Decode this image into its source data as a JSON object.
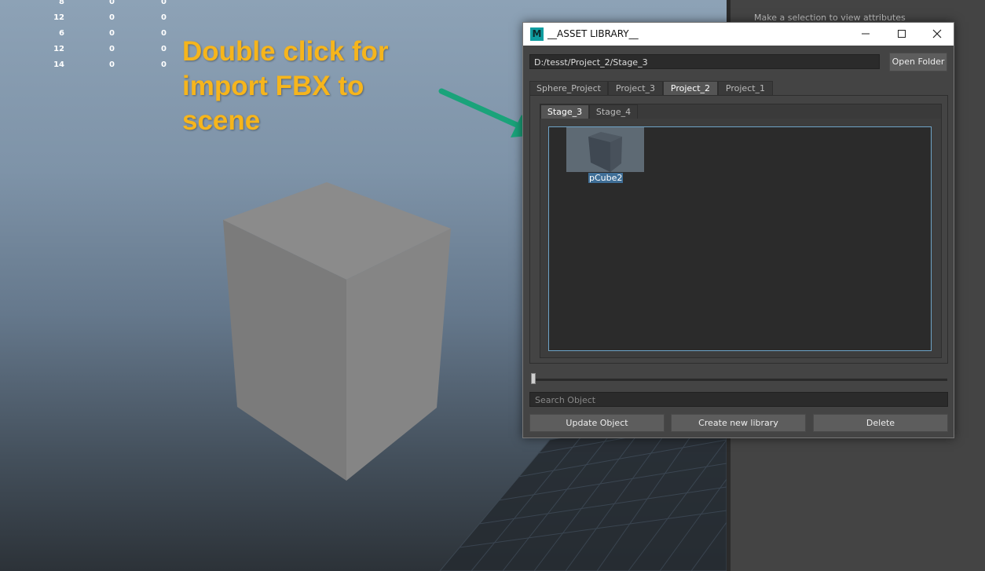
{
  "viewport": {
    "stats": [
      [
        "8",
        "0",
        "0"
      ],
      [
        "12",
        "0",
        "0"
      ],
      [
        "6",
        "0",
        "0"
      ],
      [
        "12",
        "0",
        "0"
      ],
      [
        "14",
        "0",
        "0"
      ]
    ],
    "annotation": [
      "Double click for",
      "import FBX to",
      "scene"
    ],
    "arrow_color": "#1aa37a",
    "annotation_color": "#f6b51c"
  },
  "side_panel": {
    "hint": "Make a selection to view attributes"
  },
  "window": {
    "title": "__ASSET LIBRARY__",
    "app_icon": "M",
    "path": "D:/tesst/Project_2/Stage_3",
    "open_folder": "Open Folder",
    "project_tabs": [
      "Sphere_Project",
      "Project_3",
      "Project_2",
      "Project_1"
    ],
    "active_project": "Project_2",
    "stage_tabs": [
      "Stage_3",
      "Stage_4"
    ],
    "active_stage": "Stage_3",
    "items": [
      {
        "name": "pCube2",
        "icon": "cube-thumbnail-icon"
      }
    ],
    "search_placeholder": "Search Object",
    "buttons": {
      "update": "Update Object",
      "create": "Create new library",
      "delete": "Delete"
    }
  }
}
